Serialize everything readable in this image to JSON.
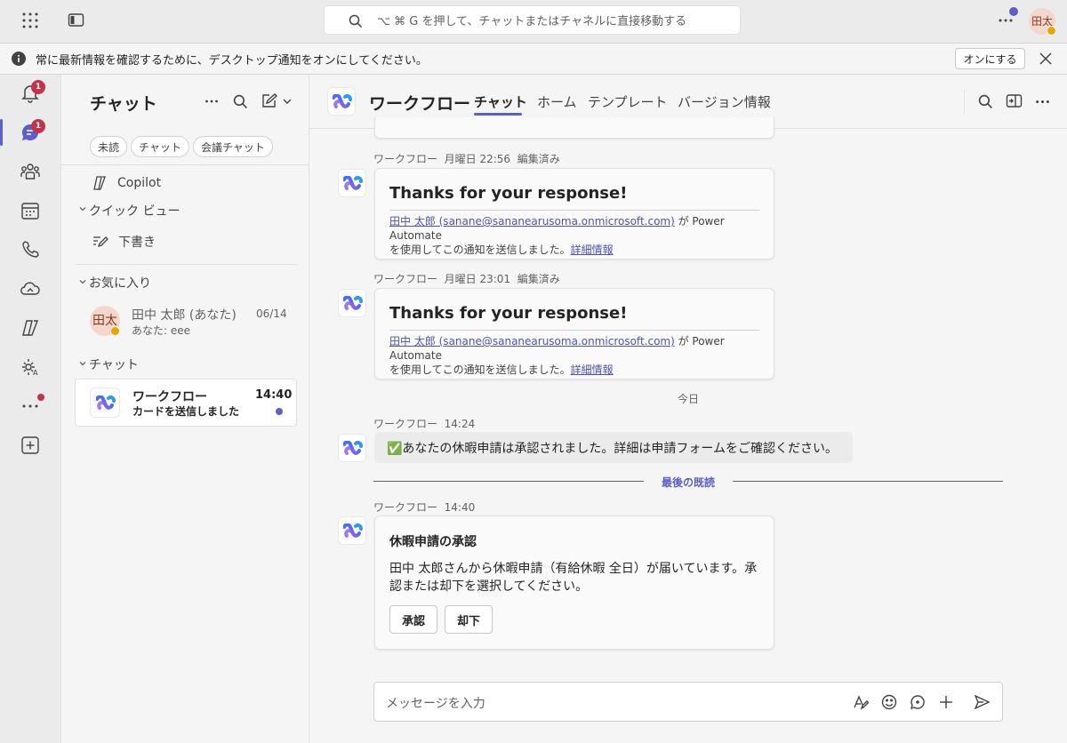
{
  "titlebar": {
    "search_placeholder": "⌥ ⌘ G を押して、チャットまたはチャネルに直接移動する",
    "avatar_initials": "田太"
  },
  "banner": {
    "text": "常に最新情報を確認するために、デスクトップ通知をオンにしてください。",
    "button_label": "オンにする"
  },
  "rail": {
    "activity_badge": "1",
    "chat_badge": "1"
  },
  "chatlist": {
    "title": "チャット",
    "filters": [
      "未読",
      "チャット",
      "会議チャット"
    ],
    "copilot_label": "Copilot",
    "quickview_label": "クイック ビュー",
    "drafts_label": "下書き",
    "favorites_label": "お気に入り",
    "favorite_item": {
      "initials": "田太",
      "name": "田中 太郎 (あなた)",
      "date": "06/14",
      "preview": "あなた: eee"
    },
    "chats_label": "チャット",
    "chat_item": {
      "name": "ワークフロー",
      "time": "14:40",
      "preview": "カードを送信しました"
    }
  },
  "chat": {
    "title": "ワークフロー",
    "tabs": [
      "チャット",
      "ホーム",
      "テンプレート",
      "バージョン情報"
    ],
    "messages": [
      {
        "sender": "ワークフロー",
        "time": "月曜日 22:56",
        "edited": "編集済み",
        "card_title": "Thanks for your response!",
        "footer_link": "田中 太郎 (sanane@sananearusoma.onmicrosoft.com)",
        "footer_text_1": " が Power Automate",
        "footer_text_2": "を使用してこの通知を送信しました。",
        "footer_more": "詳細情報"
      },
      {
        "sender": "ワークフロー",
        "time": "月曜日 23:01",
        "edited": "編集済み",
        "card_title": "Thanks for your response!",
        "footer_link": "田中 太郎 (sanane@sananearusoma.onmicrosoft.com)",
        "footer_text_1": " が Power Automate",
        "footer_text_2": "を使用してこの通知を送信しました。",
        "footer_more": "詳細情報"
      }
    ],
    "today_label": "今日",
    "msg3": {
      "sender": "ワークフロー",
      "time": "14:24",
      "text": "✅あなたの休暇申請は承認されました。詳細は申請フォームをご確認ください。"
    },
    "last_read_label": "最後の既読",
    "msg4": {
      "sender": "ワークフロー",
      "time": "14:40",
      "card_title": "休暇申請の承認",
      "body": "田中 太郎さんから休暇申請（有給休暇 全日）が届いています。承認または却下を選択してください。",
      "approve_label": "承認",
      "reject_label": "却下"
    },
    "composer_placeholder": "メッセージを入力"
  },
  "colors": {
    "accent": "#5b5fc7",
    "badge": "#c4314b",
    "link": "#4f52b2"
  }
}
